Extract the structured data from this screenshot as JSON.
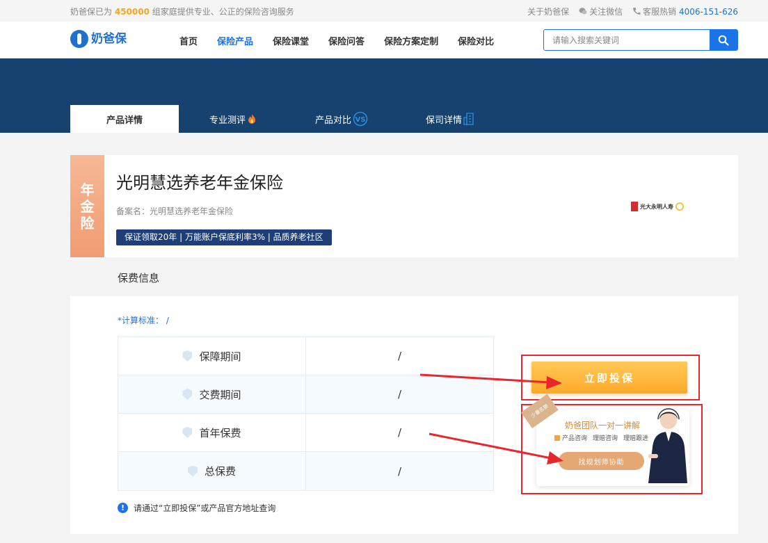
{
  "topbar": {
    "intro_prefix": "奶爸保已为",
    "intro_count": "450000",
    "intro_suffix": "组家庭提供专业、公正的保险咨询服务",
    "about": "关于奶爸保",
    "wechat": "关注微信",
    "hotline_label": "客服热销",
    "hotline_number": "4006-151-626"
  },
  "header": {
    "logo_text": "奶爸保",
    "nav": [
      "首页",
      "保险产品",
      "保险课堂",
      "保险问答",
      "保险方案定制",
      "保险对比"
    ],
    "nav_active": "保险产品",
    "search_placeholder": "请输入搜索关键词"
  },
  "tabs": [
    {
      "label": "产品详情",
      "icon": ""
    },
    {
      "label": "专业测评",
      "icon": "flame-icon"
    },
    {
      "label": "产品对比",
      "icon": "vs-icon"
    },
    {
      "label": "保司详情",
      "icon": "building-icon"
    }
  ],
  "product": {
    "ribbon": [
      "年",
      "金",
      "险"
    ],
    "title": "光明慧选养老年金保险",
    "record_name": "备案名：光明慧选养老年金保险",
    "tag": "保证领取20年 | 万能账户保底利率3% | 品质养老社区",
    "company": "光大永明人寿"
  },
  "fee": {
    "section_title": "保费信息",
    "calc_standard": "*计算标准： /",
    "rows": [
      {
        "label": "保障期间",
        "value": "/"
      },
      {
        "label": "交费期间",
        "value": "/"
      },
      {
        "label": "首年保费",
        "value": "/"
      },
      {
        "label": "总保费",
        "value": "/"
      }
    ],
    "note": "请通过“立即投保”或产品官方地址查询"
  },
  "cta": {
    "buy_label": "立即投保",
    "help_corner": "少量名额",
    "help_title": "奶爸团队一对一讲解",
    "help_items": [
      "产品咨询",
      "理赔咨询",
      "理赔跟进"
    ],
    "help_button": "找规划师协助"
  },
  "colors": {
    "primary": "#1a73e8",
    "banner": "#17426f",
    "tag_bg": "#1e3e78",
    "cta": "#ffb13a",
    "highlight_border": "#e8262b"
  }
}
